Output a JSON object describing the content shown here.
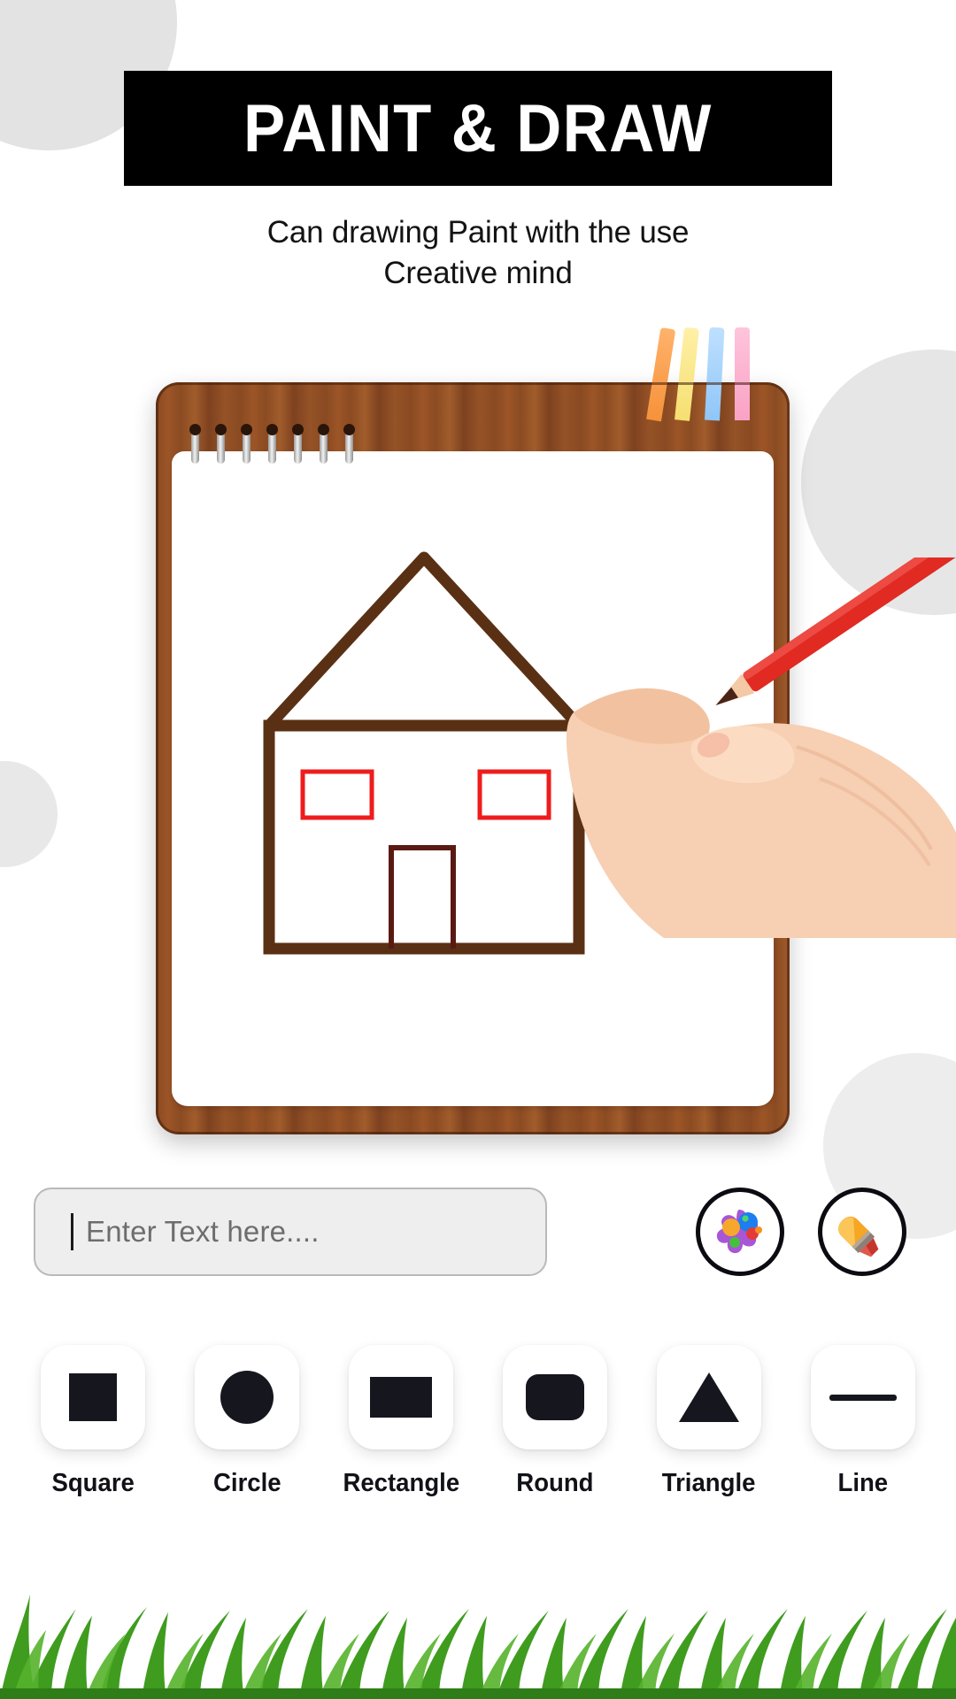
{
  "header": {
    "title": "PAINT & DRAW",
    "subtitle_line1": "Can drawing Paint with the use",
    "subtitle_line2": "Creative mind"
  },
  "canvas": {
    "drawing_name": "house-sketch",
    "stroke_color": "#5a3014",
    "window_color": "#ee1c1c",
    "door_color": "#5a1a12",
    "pencil_color": "#e02a22",
    "notepad_frame_color": "#8a4a22",
    "pencil_colors": [
      "#f6923a",
      "#f5df70",
      "#8fc6f7",
      "#f9a2c4"
    ]
  },
  "input": {
    "placeholder": "Enter Text here....",
    "value": ""
  },
  "actions": [
    {
      "name": "palette-button",
      "icon": "palette-icon"
    },
    {
      "name": "brush-button",
      "icon": "paintbrush-icon"
    }
  ],
  "shapes": [
    {
      "label": "Square",
      "icon": "square-icon"
    },
    {
      "label": "Circle",
      "icon": "circle-icon"
    },
    {
      "label": "Rectangle",
      "icon": "rectangle-icon"
    },
    {
      "label": "Round",
      "icon": "rounded-rectangle-icon"
    },
    {
      "label": "Triangle",
      "icon": "triangle-icon"
    },
    {
      "label": "Line",
      "icon": "line-icon"
    }
  ],
  "theme": {
    "banner_bg": "#000000",
    "banner_text": "#ffffff",
    "shape_icon": "#16161f",
    "field_bg": "#eeeeee",
    "field_border": "#b9b9b9",
    "grass_color": "#3f9c1f"
  }
}
